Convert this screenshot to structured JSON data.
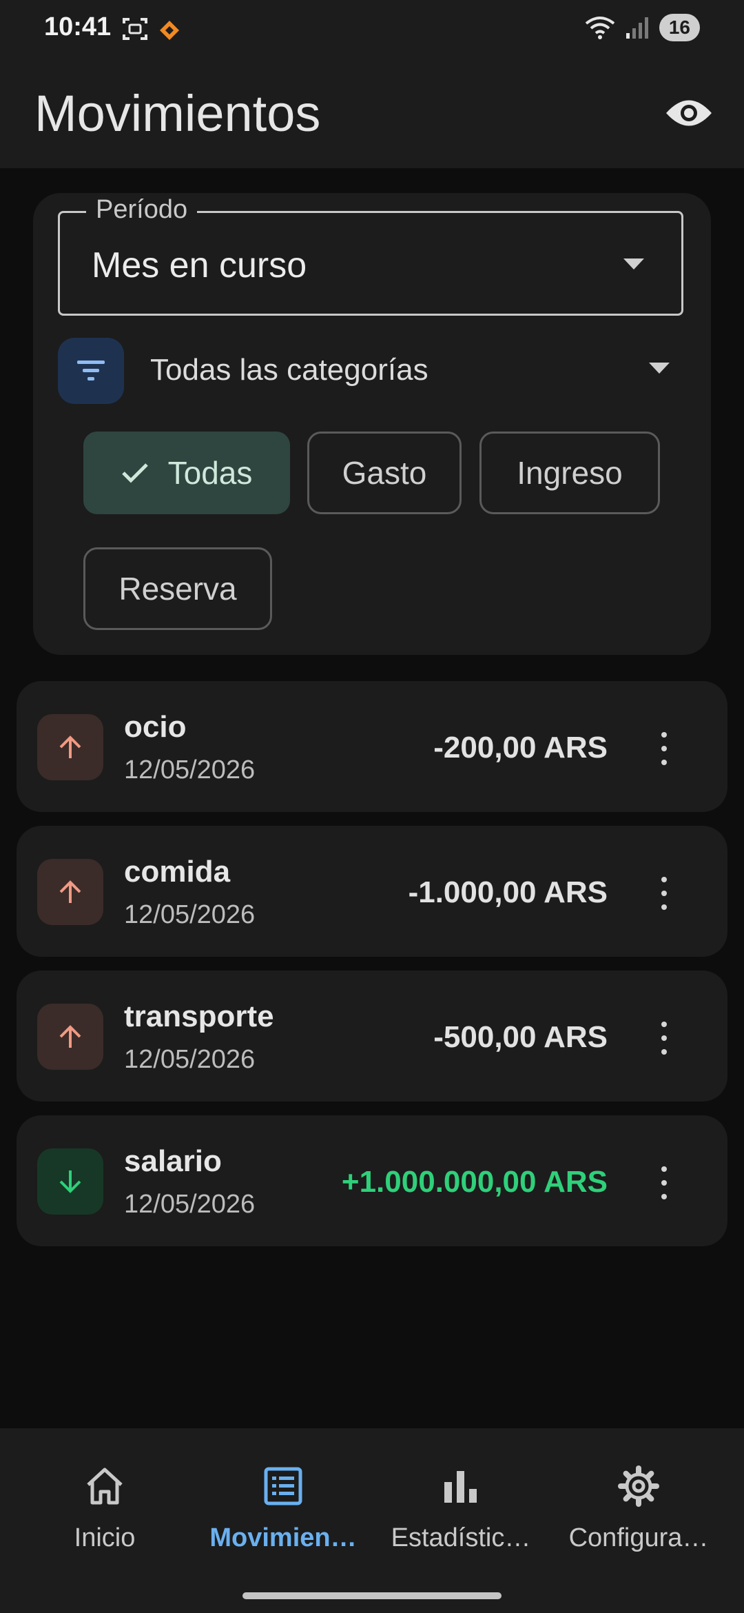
{
  "status_bar": {
    "time": "10:41",
    "battery": "16"
  },
  "app_bar": {
    "title": "Movimientos"
  },
  "filters": {
    "period_label": "Período",
    "period_value": "Mes en curso",
    "category_label": "Todas las categorías",
    "chips": [
      {
        "label": "Todas",
        "selected": true
      },
      {
        "label": "Gasto",
        "selected": false
      },
      {
        "label": "Ingreso",
        "selected": false
      },
      {
        "label": "Reserva",
        "selected": false
      }
    ]
  },
  "transactions": [
    {
      "name": "ocio",
      "date": "12/05/2026",
      "amount": "-200,00 ARS",
      "direction": "out"
    },
    {
      "name": "comida",
      "date": "12/05/2026",
      "amount": "-1.000,00 ARS",
      "direction": "out"
    },
    {
      "name": "transporte",
      "date": "12/05/2026",
      "amount": "-500,00 ARS",
      "direction": "out"
    },
    {
      "name": "salario",
      "date": "12/05/2026",
      "amount": "+1.000.000,00 ARS",
      "direction": "in"
    }
  ],
  "bottom_nav": {
    "items": [
      {
        "label": "Inicio",
        "icon": "home-icon",
        "active": false
      },
      {
        "label": "Movimien…",
        "icon": "list-icon",
        "active": true
      },
      {
        "label": "Estadístic…",
        "icon": "bar-chart-icon",
        "active": false
      },
      {
        "label": "Configura…",
        "icon": "gear-icon",
        "active": false
      }
    ]
  },
  "colors": {
    "background": "#0d0d0d",
    "surface": "#1c1c1c",
    "accent": "#6ab0f0",
    "positive": "#2fd07a",
    "expense_icon": "#f19a84",
    "chip_selected": "#2f4540"
  }
}
